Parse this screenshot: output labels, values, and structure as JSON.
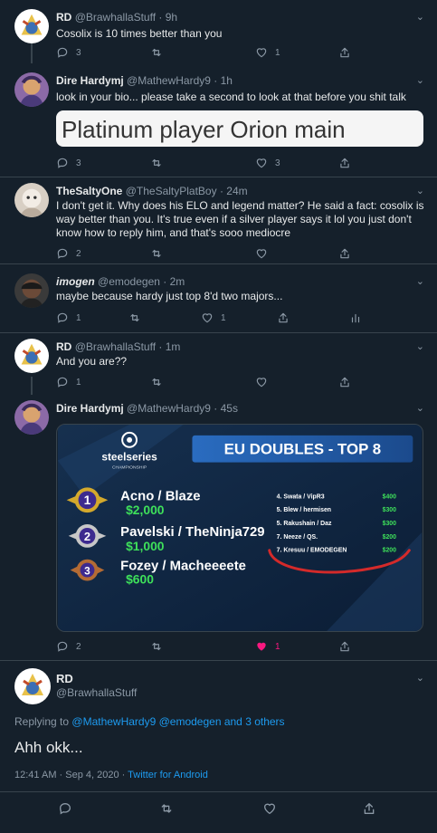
{
  "tweets": [
    {
      "name": "RD",
      "handle": "@BrawhallaStuff",
      "time": "· 9h",
      "text": "Cosolix is 10 times better than you",
      "reply_count": "3",
      "retweet_count": "",
      "like_count": "1"
    },
    {
      "name": "Dire Hardymj",
      "handle": "@MathewHardy9",
      "time": "· 1h",
      "text": "look in your bio... please take a second to look at that before you shit talk",
      "image_text": "Platinum player Orion main",
      "reply_count": "3",
      "retweet_count": "",
      "like_count": "3"
    },
    {
      "name": "TheSaltyOne",
      "handle": "@TheSaltyPlatBoy",
      "time": "· 24m",
      "text": "I don't get it. Why does his ELO and legend matter? He said a fact: cosolix is way better than you. It's true even if a silver player says it lol you just don't know how to reply him, and that's sooo mediocre",
      "reply_count": "2",
      "retweet_count": "",
      "like_count": ""
    },
    {
      "name": "imogen",
      "handle": "@emodegen",
      "time": "· 2m",
      "text": "maybe because hardy just top 8'd two majors...",
      "reply_count": "1",
      "retweet_count": "",
      "like_count": "1"
    },
    {
      "name": "RD",
      "handle": "@BrawhallaStuff",
      "time": "· 1m",
      "text": "And you are??",
      "reply_count": "1",
      "retweet_count": "",
      "like_count": ""
    },
    {
      "name": "Dire Hardymj",
      "handle": "@MathewHardy9",
      "time": "· 45s",
      "text": "",
      "reply_count": "2",
      "retweet_count": "",
      "like_count": "1"
    }
  ],
  "media": {
    "brand": "steelseries",
    "brand_sub": "CHAMPIONSHIP",
    "title": "EU DOUBLES - TOP 8",
    "podium": [
      {
        "rank": "1",
        "team": "Acno / Blaze",
        "prize": "$2,000"
      },
      {
        "rank": "2",
        "team": "Pavelski / TheNinja729",
        "prize": "$1,000"
      },
      {
        "rank": "3",
        "team": "Fozey / Macheeeete",
        "prize": "$600"
      }
    ],
    "rest": [
      {
        "team": "4. Swata / VipR3",
        "prize": "$400"
      },
      {
        "team": "5. Blew / hermisen",
        "prize": "$300"
      },
      {
        "team": "5. Rakushain / Daz",
        "prize": "$300"
      },
      {
        "team": "7. Neeze / QS.",
        "prize": "$200"
      },
      {
        "team": "7. Kresuu / EMODEGEN",
        "prize": "$200"
      }
    ]
  },
  "main_tweet": {
    "name": "RD",
    "handle": "@BrawhallaStuff",
    "replying_prefix": "Replying to",
    "replying_to": "@MathewHardy9 @emodegen and 3 others",
    "text": "Ahh okk...",
    "timestamp": "12:41 AM · Sep 4, 2020 ·",
    "source": "Twitter for Android"
  },
  "colors": {
    "background": "#15202b",
    "accent": "#1d9bf0",
    "like_active": "#f91880",
    "muted": "#8b98a5"
  }
}
